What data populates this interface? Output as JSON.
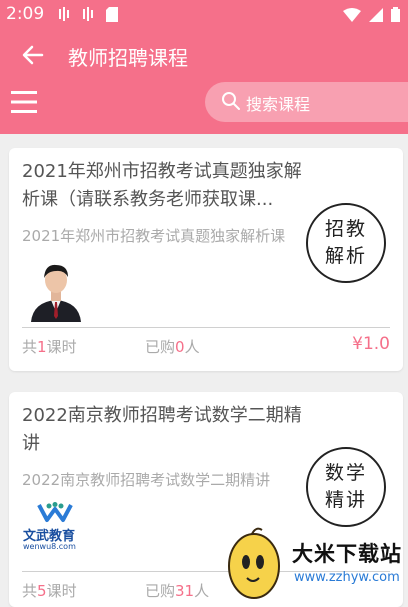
{
  "status": {
    "time": "2:09"
  },
  "header": {
    "title": "教师招聘课程"
  },
  "search": {
    "placeholder": "搜索课程"
  },
  "courses": [
    {
      "title": "2021年郑州市招教考试真题独家解析课（请联系教务老师获取课...",
      "subtitle": "2021年郑州市招教考试真题独家解析课",
      "badge_line1": "招教",
      "badge_line2": "解析",
      "lesson_prefix": "共",
      "lesson_count": "1",
      "lesson_suffix": "课时",
      "purchase_prefix": "已购",
      "purchase_count": "0",
      "purchase_suffix": "人",
      "price": "¥1.0"
    },
    {
      "title": "2022南京教师招聘考试数学二期精讲",
      "subtitle": "2022南京教师招聘考试数学二期精讲",
      "badge_line1": "数学",
      "badge_line2": "精讲",
      "logo_text": "文武教育",
      "logo_url": "wenwu8.com",
      "lesson_prefix": "共",
      "lesson_count": "5",
      "lesson_suffix": "课时",
      "purchase_prefix": "已购",
      "purchase_count": "31",
      "purchase_suffix": "人"
    }
  ],
  "watermark": {
    "name": "大米下载站",
    "url": "www.zzhyw.com"
  },
  "colors": {
    "primary": "#f5708a",
    "search_bg": "#f8a0b1",
    "background": "#efefef"
  }
}
